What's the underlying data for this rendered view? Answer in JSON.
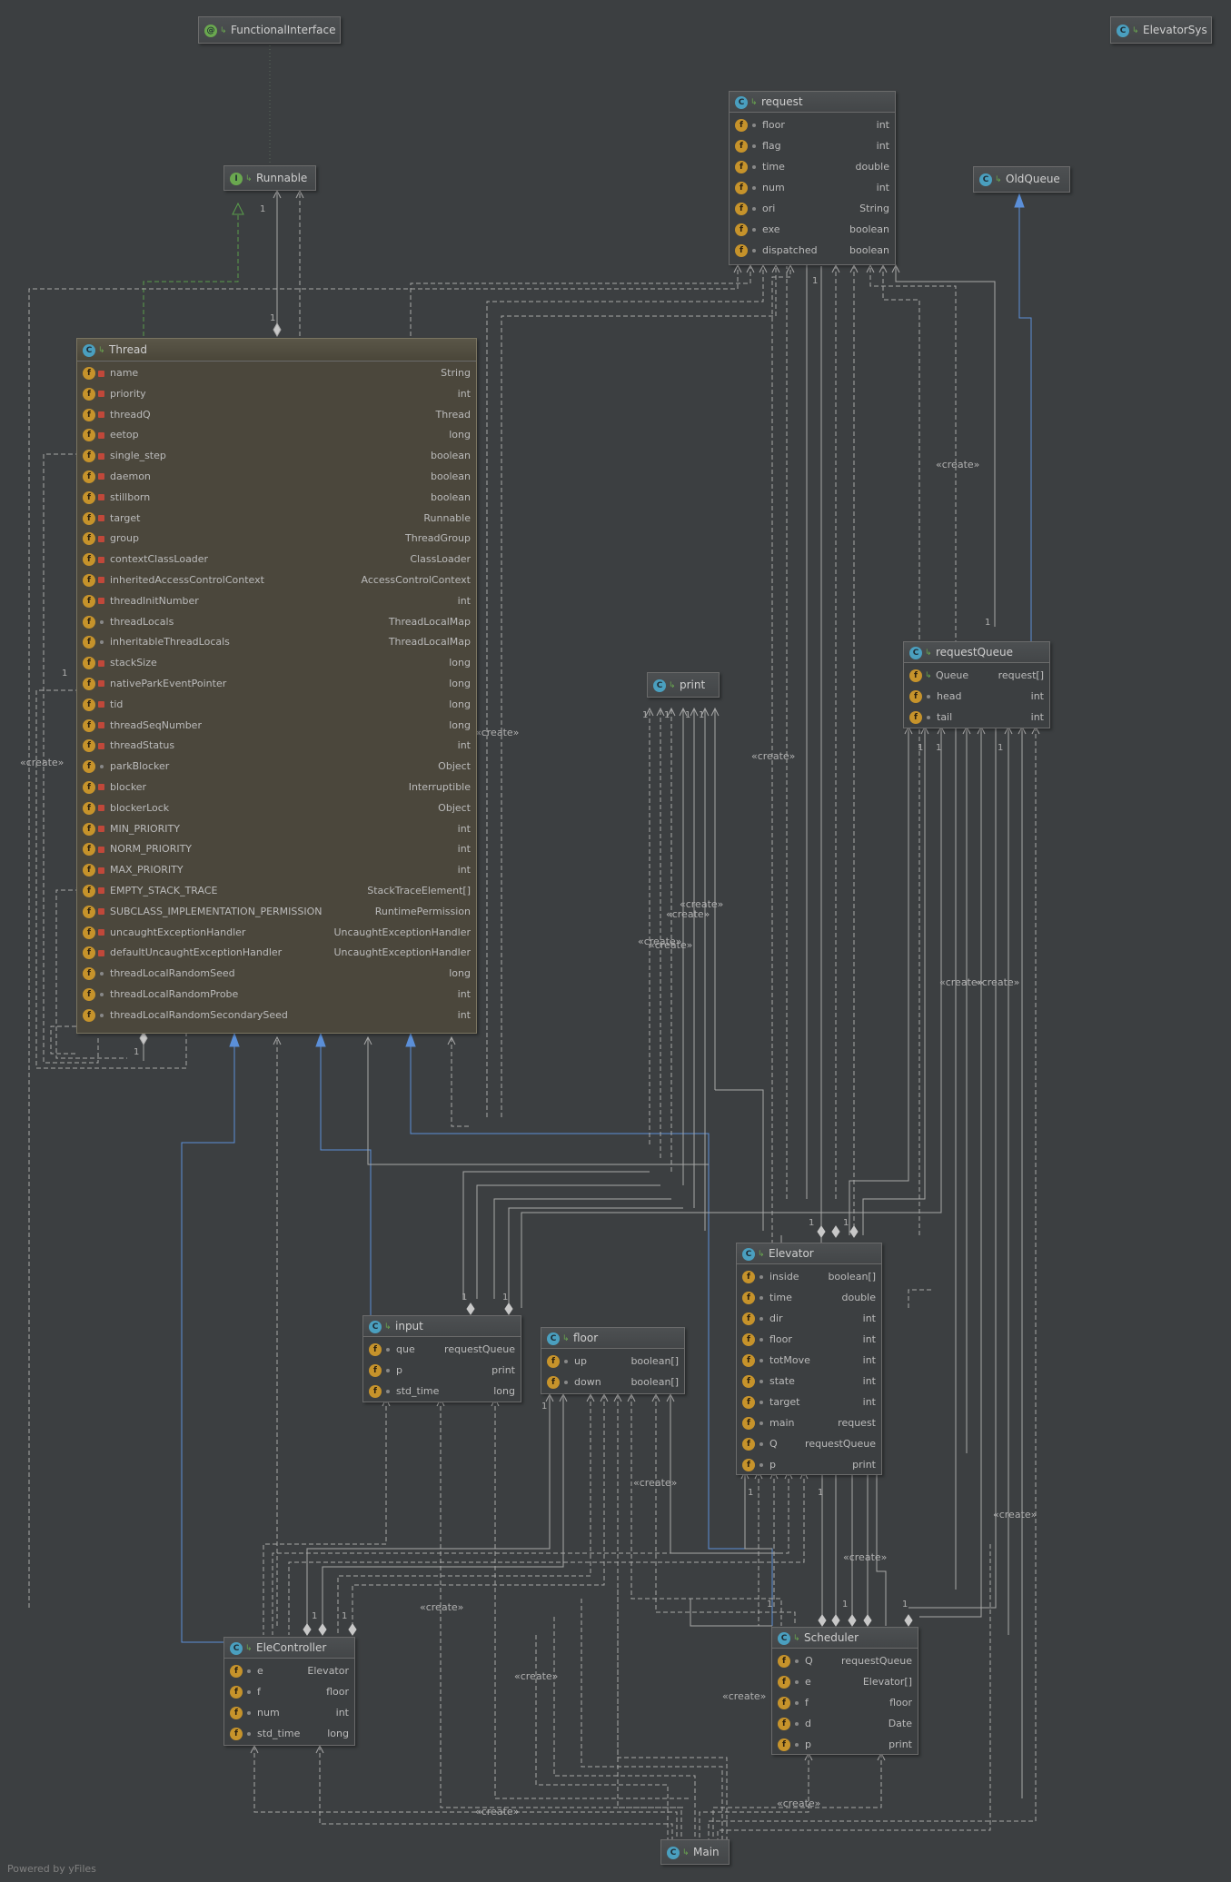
{
  "classes": {
    "functional_interface": {
      "name": "FunctionalInterface"
    },
    "elevator_sys": {
      "name": "ElevatorSys"
    },
    "runnable": {
      "name": "Runnable"
    },
    "old_queue": {
      "name": "OldQueue"
    },
    "request": {
      "name": "request",
      "fields": [
        {
          "name": "floor",
          "type": "int"
        },
        {
          "name": "flag",
          "type": "int"
        },
        {
          "name": "time",
          "type": "double"
        },
        {
          "name": "num",
          "type": "int"
        },
        {
          "name": "ori",
          "type": "String"
        },
        {
          "name": "exe",
          "type": "boolean"
        },
        {
          "name": "dispatched",
          "type": "boolean"
        }
      ]
    },
    "thread": {
      "name": "Thread",
      "fields": [
        {
          "name": "name",
          "type": "String"
        },
        {
          "name": "priority",
          "type": "int"
        },
        {
          "name": "threadQ",
          "type": "Thread"
        },
        {
          "name": "eetop",
          "type": "long"
        },
        {
          "name": "single_step",
          "type": "boolean"
        },
        {
          "name": "daemon",
          "type": "boolean"
        },
        {
          "name": "stillborn",
          "type": "boolean"
        },
        {
          "name": "target",
          "type": "Runnable"
        },
        {
          "name": "group",
          "type": "ThreadGroup"
        },
        {
          "name": "contextClassLoader",
          "type": "ClassLoader"
        },
        {
          "name": "inheritedAccessControlContext",
          "type": "AccessControlContext"
        },
        {
          "name": "threadInitNumber",
          "type": "int"
        },
        {
          "name": "threadLocals",
          "type": "ThreadLocalMap"
        },
        {
          "name": "inheritableThreadLocals",
          "type": "ThreadLocalMap"
        },
        {
          "name": "stackSize",
          "type": "long"
        },
        {
          "name": "nativeParkEventPointer",
          "type": "long"
        },
        {
          "name": "tid",
          "type": "long"
        },
        {
          "name": "threadSeqNumber",
          "type": "long"
        },
        {
          "name": "threadStatus",
          "type": "int"
        },
        {
          "name": "parkBlocker",
          "type": "Object"
        },
        {
          "name": "blocker",
          "type": "Interruptible"
        },
        {
          "name": "blockerLock",
          "type": "Object"
        },
        {
          "name": "MIN_PRIORITY",
          "type": "int"
        },
        {
          "name": "NORM_PRIORITY",
          "type": "int"
        },
        {
          "name": "MAX_PRIORITY",
          "type": "int"
        },
        {
          "name": "EMPTY_STACK_TRACE",
          "type": "StackTraceElement[]"
        },
        {
          "name": "SUBCLASS_IMPLEMENTATION_PERMISSION",
          "type": "RuntimePermission"
        },
        {
          "name": "uncaughtExceptionHandler",
          "type": "UncaughtExceptionHandler"
        },
        {
          "name": "defaultUncaughtExceptionHandler",
          "type": "UncaughtExceptionHandler"
        },
        {
          "name": "threadLocalRandomSeed",
          "type": "long"
        },
        {
          "name": "threadLocalRandomProbe",
          "type": "int"
        },
        {
          "name": "threadLocalRandomSecondarySeed",
          "type": "int"
        }
      ]
    },
    "request_queue": {
      "name": "requestQueue",
      "fields": [
        {
          "name": "Queue",
          "type": "request[]"
        },
        {
          "name": "head",
          "type": "int"
        },
        {
          "name": "tail",
          "type": "int"
        }
      ]
    },
    "print": {
      "name": "print"
    },
    "elevator": {
      "name": "Elevator",
      "fields": [
        {
          "name": "inside",
          "type": "boolean[]"
        },
        {
          "name": "time",
          "type": "double"
        },
        {
          "name": "dir",
          "type": "int"
        },
        {
          "name": "floor",
          "type": "int"
        },
        {
          "name": "totMove",
          "type": "int"
        },
        {
          "name": "state",
          "type": "int"
        },
        {
          "name": "target",
          "type": "int"
        },
        {
          "name": "main",
          "type": "request"
        },
        {
          "name": "Q",
          "type": "requestQueue"
        },
        {
          "name": "p",
          "type": "print"
        }
      ]
    },
    "input": {
      "name": "input",
      "fields": [
        {
          "name": "que",
          "type": "requestQueue"
        },
        {
          "name": "p",
          "type": "print"
        },
        {
          "name": "std_time",
          "type": "long"
        }
      ]
    },
    "floor": {
      "name": "floor",
      "fields": [
        {
          "name": "up",
          "type": "boolean[]"
        },
        {
          "name": "down",
          "type": "boolean[]"
        }
      ]
    },
    "ele_controller": {
      "name": "EleController",
      "fields": [
        {
          "name": "e",
          "type": "Elevator"
        },
        {
          "name": "f",
          "type": "floor"
        },
        {
          "name": "num",
          "type": "int"
        },
        {
          "name": "std_time",
          "type": "long"
        }
      ]
    },
    "scheduler": {
      "name": "Scheduler",
      "fields": [
        {
          "name": "Q",
          "type": "requestQueue"
        },
        {
          "name": "e",
          "type": "Elevator[]"
        },
        {
          "name": "f",
          "type": "floor"
        },
        {
          "name": "d",
          "type": "Date"
        },
        {
          "name": "p",
          "type": "print"
        }
      ]
    },
    "main": {
      "name": "Main"
    }
  },
  "labels": {
    "create": "«create»",
    "one": "1"
  },
  "footer": "Powered by yFiles",
  "colors": {
    "background": "#3c3f41",
    "wire": "#a8a8a8",
    "inherit": "#5b8fd8",
    "implements": "#5a9e4b"
  }
}
